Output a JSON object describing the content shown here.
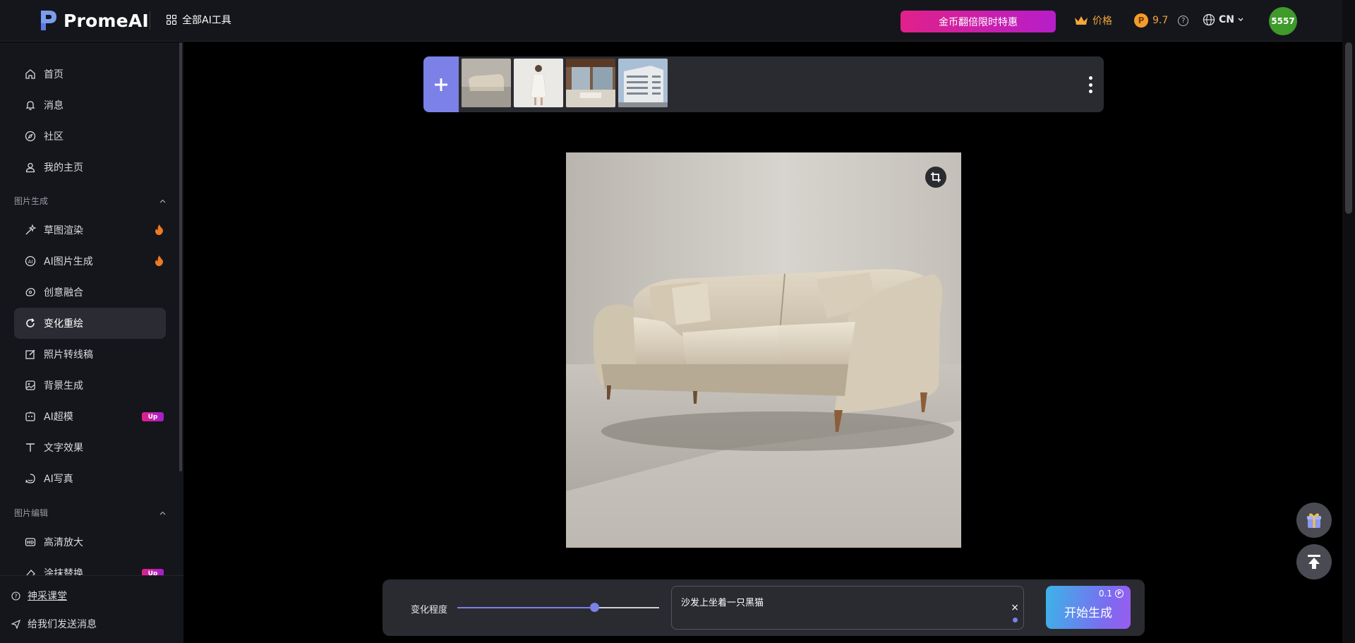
{
  "header": {
    "logo_text": "PromeAI",
    "tools_label": "全部AI工具",
    "promo_label": "金币翻倍限时特惠",
    "price_label": "价格",
    "coin_balance": "9.7",
    "coin_icon_text": "P",
    "help_text": "?",
    "lang_label": "CN",
    "avatar_text": "5557"
  },
  "sidebar": {
    "nav": [
      {
        "label": "首页",
        "icon": "home-icon"
      },
      {
        "label": "消息",
        "icon": "bell-icon"
      },
      {
        "label": "社区",
        "icon": "compass-icon"
      },
      {
        "label": "我的主页",
        "icon": "user-icon"
      }
    ],
    "section_image_gen": "图片生成",
    "image_gen_items": [
      {
        "label": "草图渲染",
        "badge": "fire"
      },
      {
        "label": "AI图片生成",
        "badge": "fire"
      },
      {
        "label": "创意融合",
        "badge": ""
      },
      {
        "label": "变化重绘",
        "badge": "",
        "active": true
      },
      {
        "label": "照片转线稿",
        "badge": ""
      },
      {
        "label": "背景生成",
        "badge": ""
      },
      {
        "label": "AI超模",
        "badge": "Up"
      },
      {
        "label": "文字效果",
        "badge": ""
      },
      {
        "label": "AI写真",
        "badge": ""
      }
    ],
    "section_image_edit": "图片编辑",
    "image_edit_items": [
      {
        "label": "高清放大",
        "badge": ""
      },
      {
        "label": "涂抹替换",
        "badge": "Up"
      }
    ],
    "footer": {
      "course_label": "神采课堂",
      "feedback_label": "给我们发送消息"
    }
  },
  "thumbnails": [
    "sofa",
    "woman in white dress",
    "interior living room",
    "modern building"
  ],
  "controls": {
    "variation_label": "变化程度",
    "variation_value": 0.68,
    "prompt_text": "沙发上坐着一只黑猫",
    "clear_symbol": "×",
    "generate_label": "开始生成",
    "generate_cost": "0.1",
    "cost_icon_text": "P"
  },
  "colors": {
    "accent": "#7b81e6",
    "promo_start": "#e0218a",
    "promo_end": "#b61ec9",
    "coin": "#f3a63b",
    "avatar": "#3e9a2a"
  }
}
